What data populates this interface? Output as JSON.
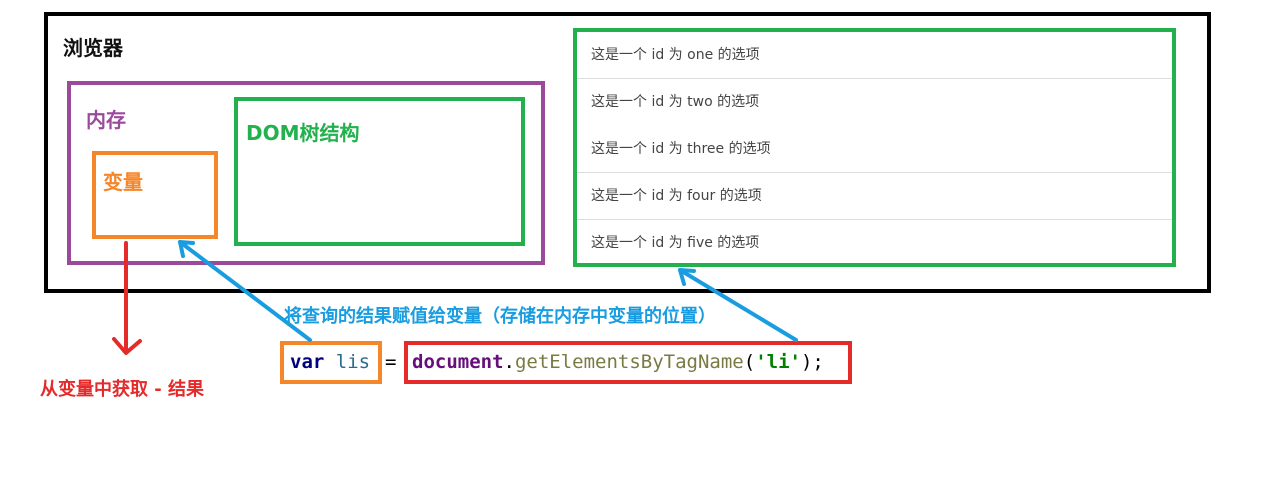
{
  "browser": {
    "title": "浏览器"
  },
  "memory": {
    "label": "内存"
  },
  "variable": {
    "label": "变量"
  },
  "dom": {
    "label": "DOM树结构"
  },
  "list_items": [
    "这是一个 id 为 one 的选项",
    "这是一个 id 为 two 的选项",
    "这是一个 id 为 three 的选项",
    "这是一个 id 为 four 的选项",
    "这是一个 id 为 five 的选项"
  ],
  "annotations": {
    "assign": "将查询的结果赋值给变量（存储在内存中变量的位置）",
    "result": "从变量中获取 - 结果"
  },
  "code": {
    "keyword": "var",
    "identifier": "lis",
    "equals": "=",
    "object": "document",
    "dot": ".",
    "method": "getElementsByTagName",
    "open_paren": "(",
    "string_arg": "'li'",
    "close": ");"
  },
  "colors": {
    "browser_border": "#000000",
    "memory": "#9b4a9b",
    "variable": "#f5862a",
    "dom": "#22b14c",
    "annotation_blue": "#1a9de0",
    "result_red": "#e52a2a",
    "code_keyword": "#000080",
    "code_identifier": "#2b6b8c",
    "code_object": "#660e7a",
    "code_method": "#7a7a43",
    "code_string": "#008000"
  }
}
